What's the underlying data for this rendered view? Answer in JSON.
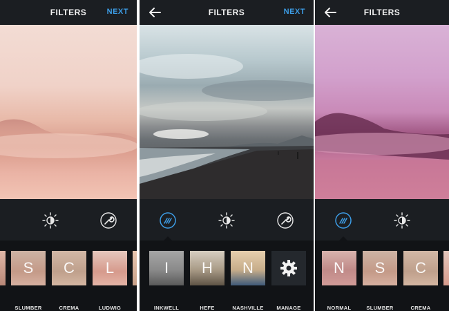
{
  "screens": [
    {
      "title": "FILTERS",
      "next_label": "NEXT",
      "filters": [
        {
          "letter": "S",
          "label": "SLUMBER"
        },
        {
          "letter": "C",
          "label": "CREMA"
        },
        {
          "letter": "L",
          "label": "LUDWIG"
        }
      ]
    },
    {
      "title": "FILTERS",
      "next_label": "NEXT",
      "filters": [
        {
          "letter": "I",
          "label": "INKWELL"
        },
        {
          "letter": "H",
          "label": "HEFE"
        },
        {
          "letter": "N",
          "label": "NASHVILLE"
        },
        {
          "letter": "",
          "label": "MANAGE"
        }
      ]
    },
    {
      "title": "FILTERS",
      "filters": [
        {
          "letter": "N",
          "label": "NORMAL"
        },
        {
          "letter": "S",
          "label": "SLUMBER"
        },
        {
          "letter": "C",
          "label": "CREMA"
        }
      ]
    }
  ],
  "colors": {
    "accent": "#3d9ee8",
    "bar": "#1b1e22",
    "strip": "#111316"
  },
  "icons": [
    "back-arrow-icon",
    "filter-wand-icon",
    "brightness-icon",
    "wrench-icon",
    "gear-icon"
  ]
}
